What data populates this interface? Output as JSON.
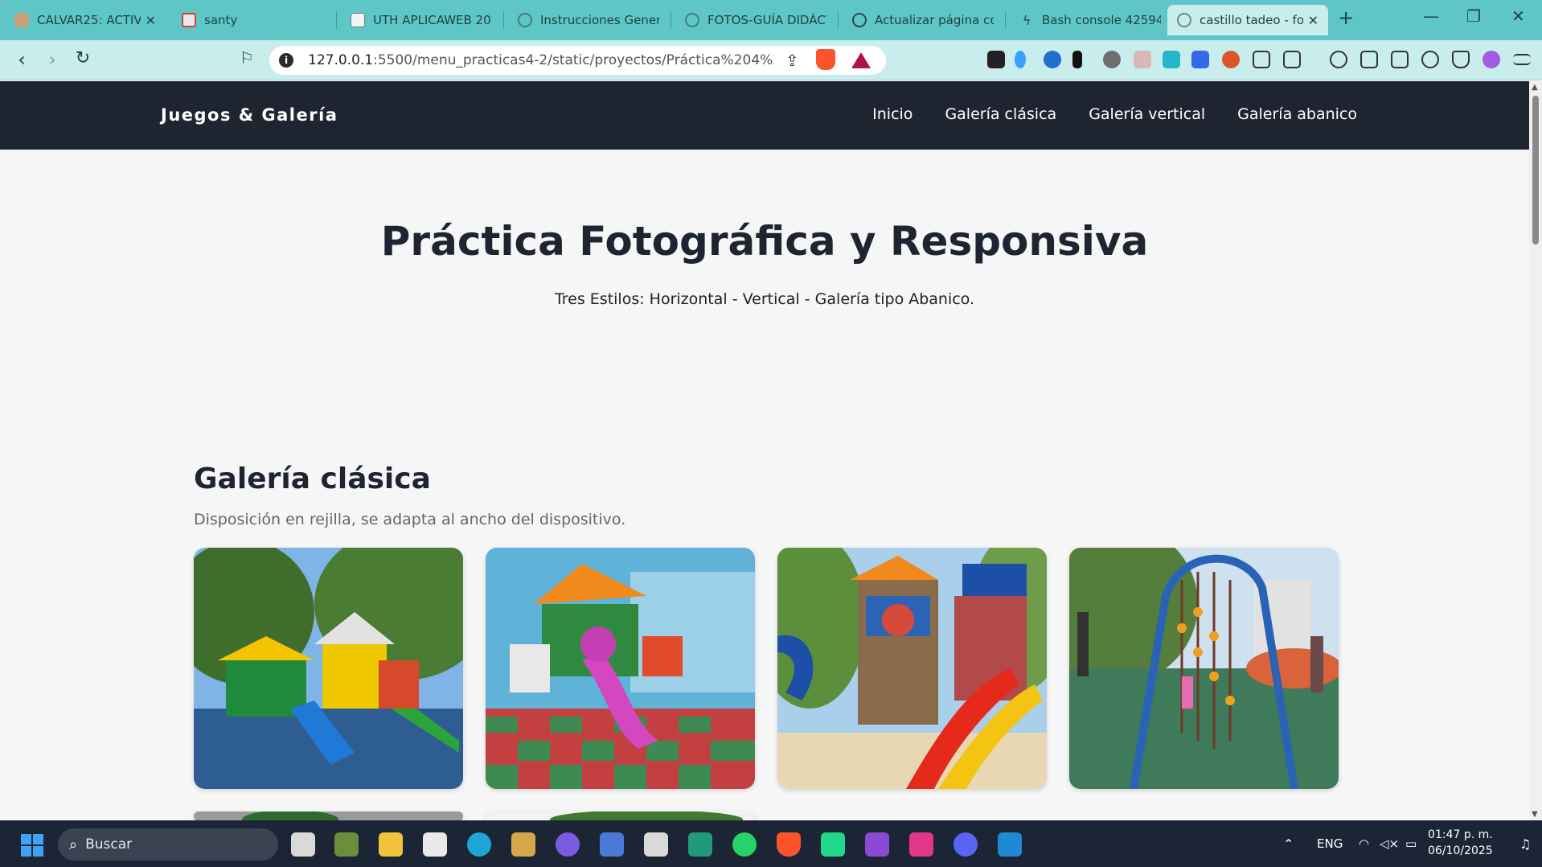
{
  "browser": {
    "tabs": [
      {
        "title": "CALVAR25: ACTIVI",
        "active": false
      },
      {
        "title": "santy",
        "active": false
      },
      {
        "title": "UTH APLICAWEB 2025",
        "active": false
      },
      {
        "title": "Instrucciones Generales",
        "active": false
      },
      {
        "title": "FOTOS-GUÍA DIDÁCTI",
        "active": false
      },
      {
        "title": "Actualizar página con",
        "active": false
      },
      {
        "title": "Bash console 425945",
        "active": false
      },
      {
        "title": "castillo tadeo - fo",
        "active": true
      }
    ],
    "new_tab": "+",
    "window_controls": {
      "minimize": "—",
      "restore": "❐",
      "close": "✕"
    },
    "url_host": "127.0.0.1",
    "url_path": ":5500/menu_practicas4-2/static/proyectos/Práctica%204%20Fot..."
  },
  "site": {
    "brand": "Juegos & Galería",
    "nav": [
      "Inicio",
      "Galería clásica",
      "Galería vertical",
      "Galería abanico"
    ],
    "hero_title": "Práctica Fotográfica y Responsiva",
    "hero_subtitle": "Tres Estilos: Horizontal - Vertical - Galería tipo Abanico.",
    "gallery_title": "Galería clásica",
    "gallery_subtitle": "Disposición en rejilla, se adapta al ancho del dispositivo."
  },
  "taskbar": {
    "search_placeholder": "Buscar",
    "language": "ENG",
    "time": "01:47 p. m.",
    "date": "06/10/2025"
  }
}
